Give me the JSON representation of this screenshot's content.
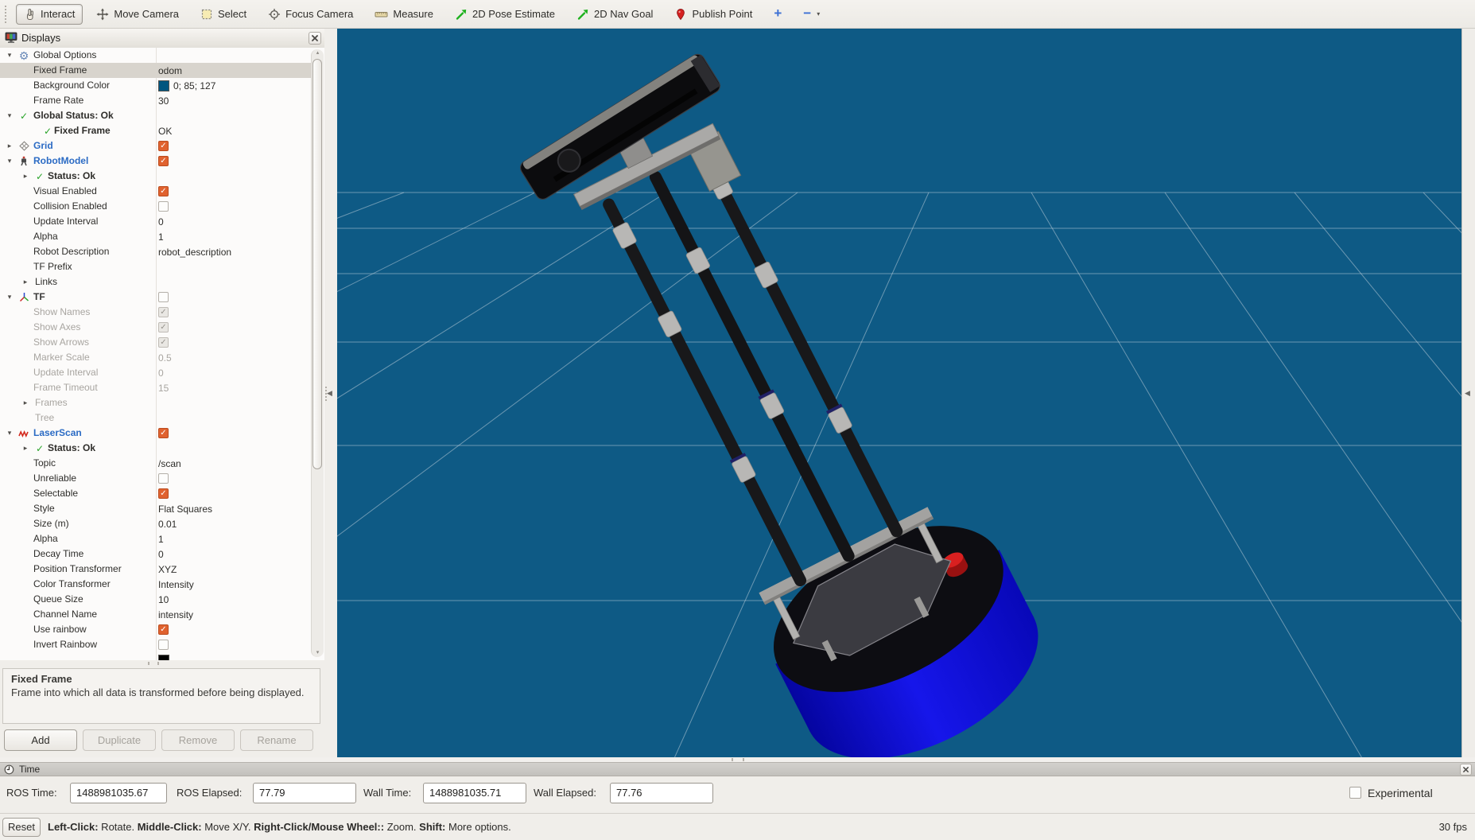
{
  "toolbar": {
    "tools": [
      {
        "id": "interact",
        "label": "Interact",
        "icon": "hand",
        "active": true
      },
      {
        "id": "move-camera",
        "label": "Move Camera",
        "icon": "move",
        "active": false
      },
      {
        "id": "select",
        "label": "Select",
        "icon": "select",
        "active": false
      },
      {
        "id": "focus-camera",
        "label": "Focus Camera",
        "icon": "focus",
        "active": false
      },
      {
        "id": "measure",
        "label": "Measure",
        "icon": "ruler",
        "active": false
      },
      {
        "id": "2d-pose-estimate",
        "label": "2D Pose Estimate",
        "icon": "green-arrow",
        "active": false
      },
      {
        "id": "2d-nav-goal",
        "label": "2D Nav Goal",
        "icon": "green-arrow",
        "active": false
      },
      {
        "id": "publish-point",
        "label": "Publish Point",
        "icon": "pin",
        "active": false
      },
      {
        "id": "add-tool",
        "label": "+",
        "icon": "plus",
        "active": false
      },
      {
        "id": "remove-tool",
        "label": "−",
        "icon": "minus",
        "active": false,
        "caret": true
      }
    ]
  },
  "displays_panel": {
    "title": "Displays",
    "rows": [
      {
        "type": "top",
        "exp": "open",
        "icon": "gear",
        "label": "Global Options"
      },
      {
        "type": "prop",
        "label": "Fixed Frame",
        "value": "odom",
        "selected": true
      },
      {
        "type": "prop",
        "label": "Background Color",
        "swatch": "#00557f",
        "value": "0; 85; 127"
      },
      {
        "type": "prop",
        "label": "Frame Rate",
        "value": "30"
      },
      {
        "type": "top",
        "exp": "open",
        "icon": "check",
        "label": "Global Status: Ok",
        "style": "bold"
      },
      {
        "type": "subchild",
        "icon": "check",
        "label": "Fixed Frame",
        "style": "bold",
        "value": "OK"
      },
      {
        "type": "top",
        "exp": "closed",
        "icon": "grid",
        "label": "Grid",
        "style": "blue",
        "check": "on"
      },
      {
        "type": "top",
        "exp": "open",
        "icon": "robot",
        "label": "RobotModel",
        "style": "blue",
        "check": "on"
      },
      {
        "type": "sub",
        "exp": "closed",
        "icon": "check",
        "label": "Status: Ok",
        "style": "bold"
      },
      {
        "type": "prop",
        "label": "Visual Enabled",
        "check": "on"
      },
      {
        "type": "prop",
        "label": "Collision Enabled",
        "check": "off"
      },
      {
        "type": "prop",
        "label": "Update Interval",
        "value": "0"
      },
      {
        "type": "prop",
        "label": "Alpha",
        "value": "1"
      },
      {
        "type": "prop",
        "label": "Robot Description",
        "value": "robot_description"
      },
      {
        "type": "prop",
        "label": "TF Prefix",
        "value": ""
      },
      {
        "type": "sub",
        "exp": "closed",
        "label": "Links"
      },
      {
        "type": "top",
        "exp": "open",
        "icon": "tf",
        "label": "TF",
        "style": "dark",
        "check": "off"
      },
      {
        "type": "prop",
        "label": "Show Names",
        "check": "ondis",
        "disabled": true
      },
      {
        "type": "prop",
        "label": "Show Axes",
        "check": "ondis",
        "disabled": true
      },
      {
        "type": "prop",
        "label": "Show Arrows",
        "check": "ondis",
        "disabled": true
      },
      {
        "type": "prop",
        "label": "Marker Scale",
        "value": "0.5",
        "disabled": true
      },
      {
        "type": "prop",
        "label": "Update Interval",
        "value": "0",
        "disabled": true
      },
      {
        "type": "prop",
        "label": "Frame Timeout",
        "value": "15",
        "disabled": true
      },
      {
        "type": "sub",
        "exp": "closed",
        "label": "Frames",
        "disabled": true
      },
      {
        "type": "sub",
        "label": "Tree",
        "disabled": true
      },
      {
        "type": "top",
        "exp": "open",
        "icon": "laser",
        "label": "LaserScan",
        "style": "blue",
        "check": "on"
      },
      {
        "type": "sub",
        "exp": "closed",
        "icon": "check",
        "label": "Status: Ok",
        "style": "bold"
      },
      {
        "type": "prop",
        "label": "Topic",
        "value": "/scan"
      },
      {
        "type": "prop",
        "label": "Unreliable",
        "check": "off"
      },
      {
        "type": "prop",
        "label": "Selectable",
        "check": "on"
      },
      {
        "type": "prop",
        "label": "Style",
        "value": "Flat Squares"
      },
      {
        "type": "prop",
        "label": "Size (m)",
        "value": "0.01"
      },
      {
        "type": "prop",
        "label": "Alpha",
        "value": "1"
      },
      {
        "type": "prop",
        "label": "Decay Time",
        "value": "0"
      },
      {
        "type": "prop",
        "label": "Position Transformer",
        "value": "XYZ"
      },
      {
        "type": "prop",
        "label": "Color Transformer",
        "value": "Intensity"
      },
      {
        "type": "prop",
        "label": "Queue Size",
        "value": "10"
      },
      {
        "type": "prop",
        "label": "Channel Name",
        "value": "intensity"
      },
      {
        "type": "prop",
        "label": "Use rainbow",
        "check": "on"
      },
      {
        "type": "prop",
        "label": "Invert Rainbow",
        "check": "off"
      },
      {
        "type": "prop",
        "label": "",
        "swatch": "#000000",
        "value": ""
      }
    ],
    "help": {
      "title": "Fixed Frame",
      "body": "Frame into which all data is transformed before being displayed."
    },
    "buttons": [
      {
        "label": "Add",
        "enabled": true
      },
      {
        "label": "Duplicate",
        "enabled": false
      },
      {
        "label": "Remove",
        "enabled": false
      },
      {
        "label": "Rename",
        "enabled": false
      }
    ]
  },
  "viewport": {
    "background_color": "#0e5a85",
    "grid_color": "rgba(200,214,224,0.5)"
  },
  "time_panel": {
    "title": "Time",
    "fields": [
      {
        "label": "ROS Time:",
        "value": "1488981035.67"
      },
      {
        "label": "ROS Elapsed:",
        "value": "77.79"
      },
      {
        "label": "Wall Time:",
        "value": "1488981035.71"
      },
      {
        "label": "Wall Elapsed:",
        "value": "77.76"
      }
    ],
    "experimental_label": "Experimental",
    "experimental_checked": false
  },
  "status_bar": {
    "reset_label": "Reset",
    "segments": [
      {
        "bold": true,
        "text": "Left-Click:"
      },
      {
        "bold": false,
        "text": " Rotate.  "
      },
      {
        "bold": true,
        "text": "Middle-Click:"
      },
      {
        "bold": false,
        "text": " Move X/Y.  "
      },
      {
        "bold": true,
        "text": "Right-Click/Mouse Wheel::"
      },
      {
        "bold": false,
        "text": " Zoom.  "
      },
      {
        "bold": true,
        "text": "Shift:"
      },
      {
        "bold": false,
        "text": " More options."
      }
    ],
    "fps": "30 fps"
  }
}
